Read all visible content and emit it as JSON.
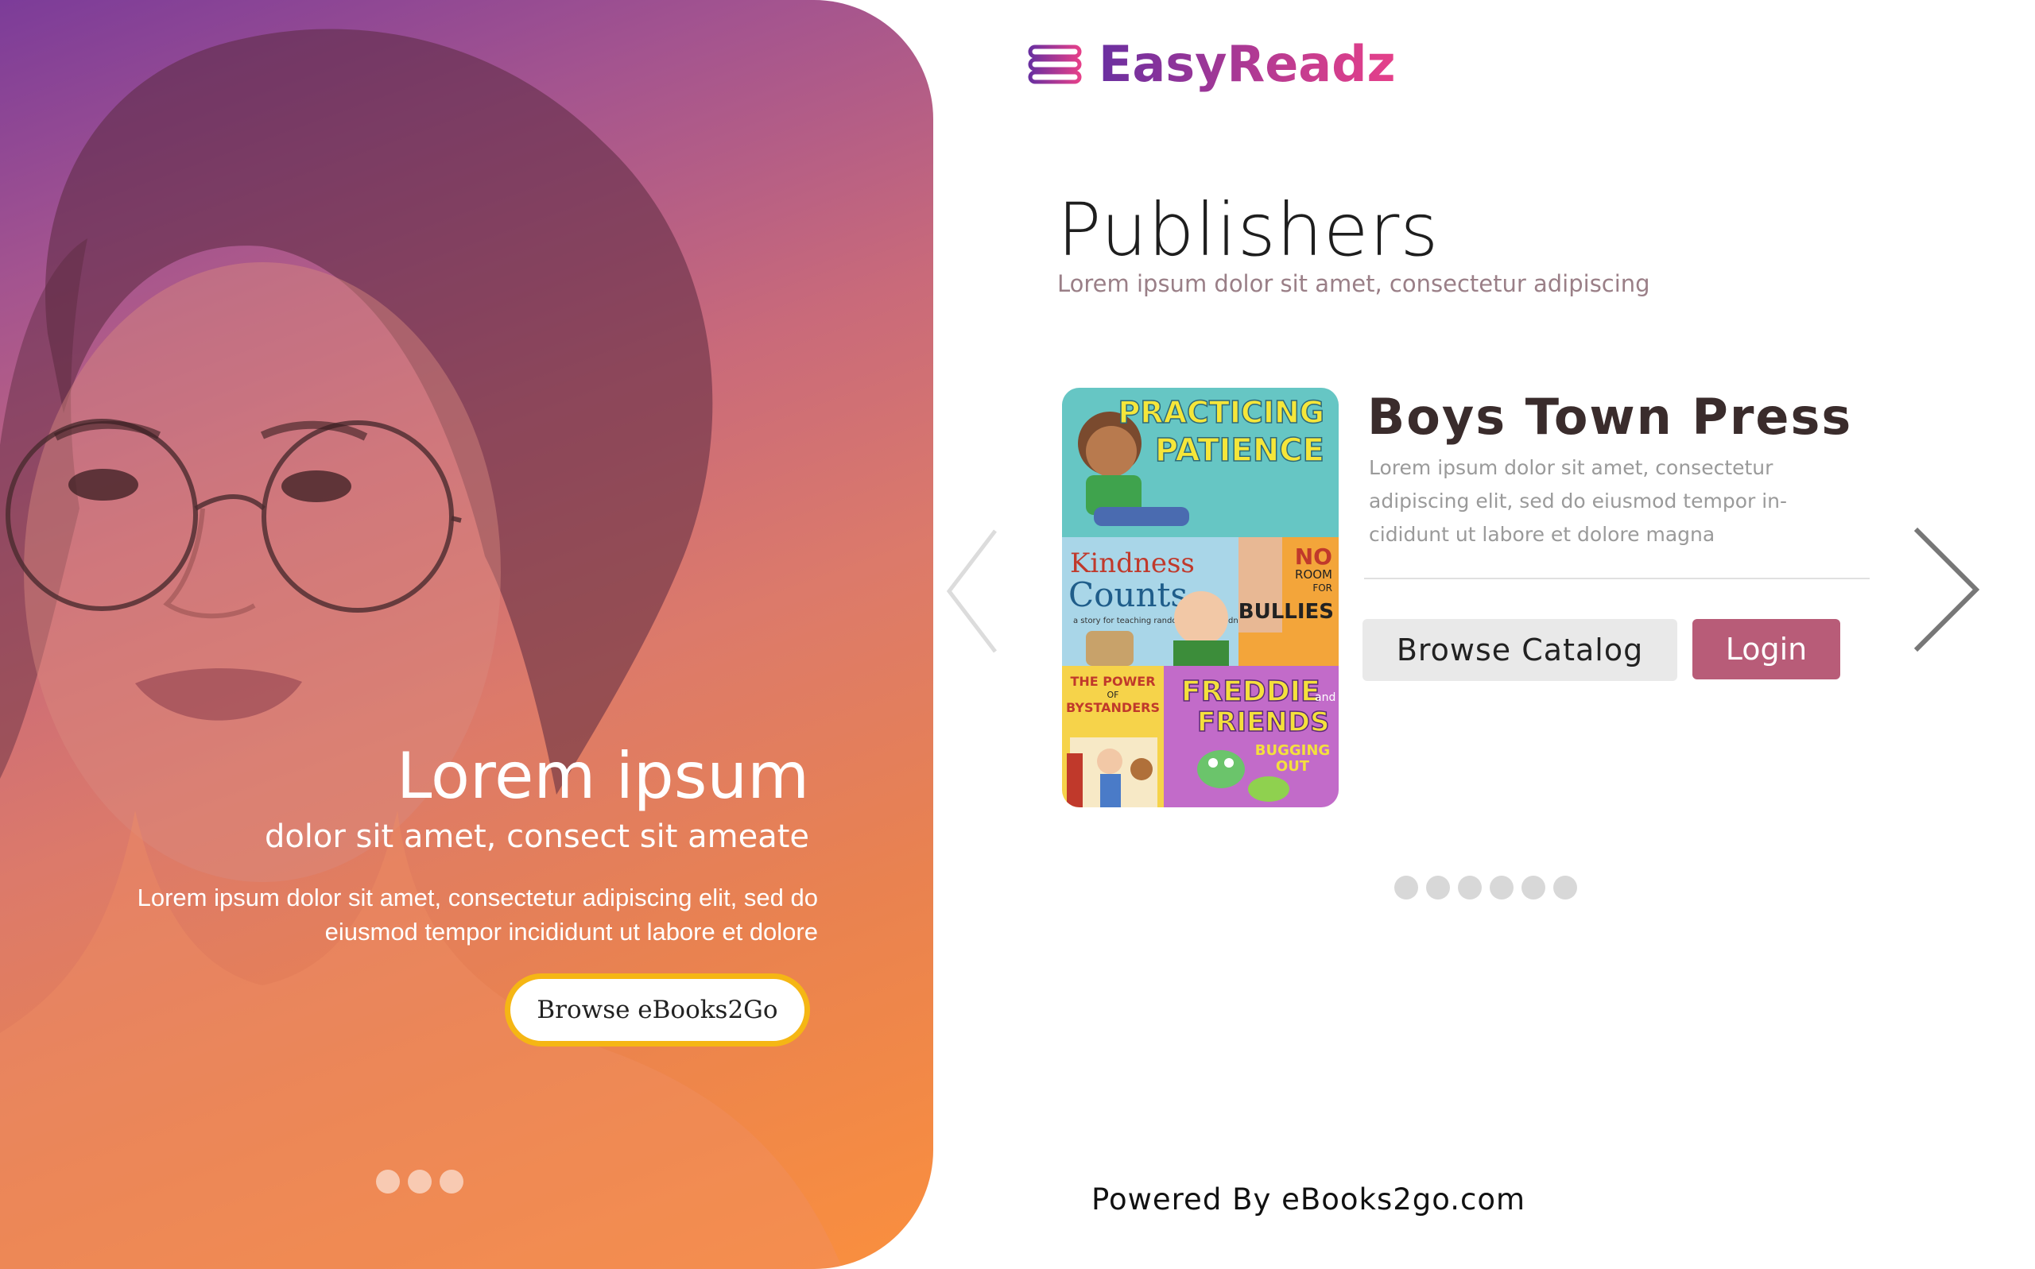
{
  "hero": {
    "title": "Lorem ipsum",
    "subtitle": "dolor sit amet, consect sit ameate",
    "text": "Lorem ipsum dolor sit amet, consectetur adipiscing elit, sed do eiusmod tempor incididunt ut labore et dolore",
    "button_label": "Browse eBooks2Go",
    "dot_count": 3
  },
  "brand": {
    "name": "EasyReadz",
    "icon": "stacked-books-icon"
  },
  "section": {
    "title": "Publishers",
    "subtitle": "Lorem ipsum dolor sit amet, consectetur adipiscing"
  },
  "publisher": {
    "name": "Boys Town Press",
    "description": "Lorem ipsum dolor sit amet, consectetur adipiscing elit, sed do eiusmod tempor in-cididunt ut labore et dolore magna",
    "browse_label": "Browse Catalog",
    "login_label": "Login",
    "cover_titles": {
      "practicing": "PRACTICING",
      "patience": "PATIENCE",
      "kindness": "Kindness",
      "counts": "Counts",
      "kindness_sub": "a story for teaching random acts of kindness",
      "no": "NO",
      "room": "ROOM",
      "for": "FOR",
      "bullies": "BULLIES",
      "power": "THE POWER",
      "of": "OF",
      "bystanders": "BYSTANDERS",
      "freddie": "FREDDIE",
      "and": "and",
      "friends": "FRIENDS",
      "bugging": "BUGGING",
      "out": "OUT"
    }
  },
  "carousel": {
    "dot_count": 6
  },
  "footer": {
    "text": "Powered By eBooks2go.com"
  },
  "colors": {
    "accent": "#b85c78",
    "button_border": "#f5b614",
    "brand_gradient_start": "#6a2fa0",
    "brand_gradient_end": "#e5408a"
  }
}
